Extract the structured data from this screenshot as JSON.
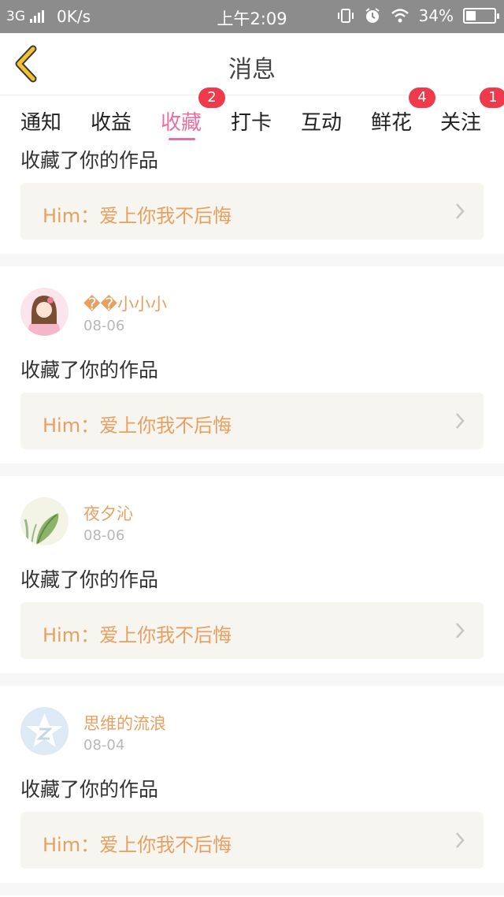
{
  "status_bar": {
    "network_type": "3G",
    "speed": "0K/s",
    "time": "上午2:09",
    "battery_percent": "34%",
    "battery_level": 0.34
  },
  "header": {
    "title": "消息",
    "back_icon": "chevron-left-icon",
    "accent_color": "#f2c230"
  },
  "tabs": [
    {
      "label": "通知",
      "badge": ""
    },
    {
      "label": "收益",
      "badge": ""
    },
    {
      "label": "收藏",
      "badge": "2",
      "active": true
    },
    {
      "label": "打卡",
      "badge": ""
    },
    {
      "label": "互动",
      "badge": ""
    },
    {
      "label": "鲜花",
      "badge": "4"
    },
    {
      "label": "关注",
      "badge": "1"
    }
  ],
  "colors": {
    "active_tab": "#e86fa2",
    "badge": "#ee3a4b",
    "username": "#e8a060",
    "work_text": "#e8a060",
    "card_bg": "#f6f5ef"
  },
  "items": [
    {
      "action": "收藏了你的作品",
      "work": "Him：爱上你我不后悔"
    },
    {
      "username": "��小小小",
      "date": "08-06",
      "action": "收藏了你的作品",
      "work": "Him：爱上你我不后悔"
    },
    {
      "username": "夜夕沁",
      "date": "08-06",
      "action": "收藏了你的作品",
      "work": "Him：爱上你我不后悔"
    },
    {
      "username": "思维的流浪",
      "date": "08-04",
      "action": "收藏了你的作品",
      "work": "Him：爱上你我不后悔"
    }
  ]
}
